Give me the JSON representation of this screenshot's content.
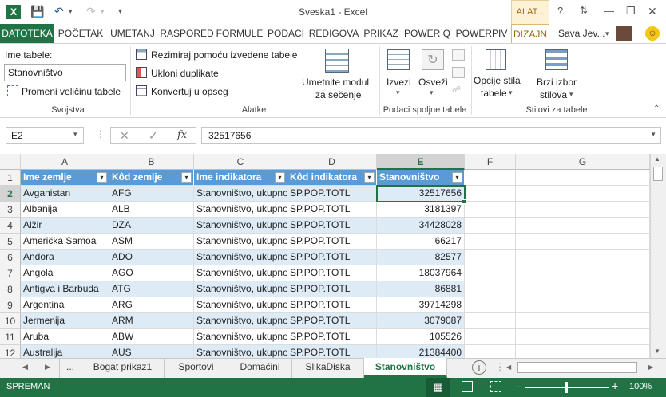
{
  "window": {
    "title": "Sveska1 - Excel",
    "contextual_tab_group": "ALAT...",
    "user_name": "Sava Jev..."
  },
  "ribbon_tabs": [
    "DATOTEKA",
    "POČETAK",
    "UMETANJ",
    "RASPORED",
    "FORMULE",
    "PODACI",
    "REDIGOVA",
    "PRIKAZ",
    "POWER Q",
    "POWERPIV",
    "DIZAJN"
  ],
  "ribbon": {
    "svojstva": {
      "name_label": "Ime tabele:",
      "name_value": "Stanovništvo",
      "resize_label": "Promeni veličinu tabele",
      "group_label": "Svojstva"
    },
    "alatke": {
      "pivot_label": "Rezimiraj pomoću izvedene tabele",
      "dupes_label": "Ukloni duplikate",
      "convert_label": "Konvertuj u opseg",
      "slicer_label_1": "Umetnite modul",
      "slicer_label_2": "za sečenje",
      "group_label": "Alatke"
    },
    "spoljni": {
      "export_label": "Izvezi",
      "refresh_label": "Osveži",
      "group_label": "Podaci spoljne tabele"
    },
    "stilovi": {
      "options_label_1": "Opcije stila",
      "options_label_2": "tabele",
      "quick_label_1": "Brzi izbor",
      "quick_label_2": "stilova",
      "group_label": "Stilovi za tabele"
    }
  },
  "formula_bar": {
    "name_box": "E2",
    "formula": "32517656"
  },
  "columns": [
    "A",
    "B",
    "C",
    "D",
    "E",
    "F",
    "G"
  ],
  "table_headers": [
    "Ime zemlje",
    "Kôd zemlje",
    "Ime indikatora",
    "Kôd indikatora",
    "Stanovništvo"
  ],
  "rows": [
    {
      "n": "2",
      "a": "Avganistan",
      "b": "AFG",
      "c": "Stanovništvo, ukupno",
      "d": "SP.POP.TOTL",
      "e": "32517656"
    },
    {
      "n": "3",
      "a": "Albanija",
      "b": "ALB",
      "c": "Stanovništvo, ukupno",
      "d": "SP.POP.TOTL",
      "e": "3181397"
    },
    {
      "n": "4",
      "a": "Alžir",
      "b": "DZA",
      "c": "Stanovništvo, ukupno",
      "d": "SP.POP.TOTL",
      "e": "34428028"
    },
    {
      "n": "5",
      "a": "Američka Samoa",
      "b": "ASM",
      "c": "Stanovništvo, ukupno",
      "d": "SP.POP.TOTL",
      "e": "66217"
    },
    {
      "n": "6",
      "a": "Andora",
      "b": "ADO",
      "c": "Stanovništvo, ukupno",
      "d": "SP.POP.TOTL",
      "e": "82577"
    },
    {
      "n": "7",
      "a": "Angola",
      "b": "AGO",
      "c": "Stanovništvo, ukupno",
      "d": "SP.POP.TOTL",
      "e": "18037964"
    },
    {
      "n": "8",
      "a": "Antigva i Barbuda",
      "b": "ATG",
      "c": "Stanovništvo, ukupno",
      "d": "SP.POP.TOTL",
      "e": "86881"
    },
    {
      "n": "9",
      "a": "Argentina",
      "b": "ARG",
      "c": "Stanovništvo, ukupno",
      "d": "SP.POP.TOTL",
      "e": "39714298"
    },
    {
      "n": "10",
      "a": "Jermenija",
      "b": "ARM",
      "c": "Stanovništvo, ukupno",
      "d": "SP.POP.TOTL",
      "e": "3079087"
    },
    {
      "n": "11",
      "a": "Aruba",
      "b": "ABW",
      "c": "Stanovništvo, ukupno",
      "d": "SP.POP.TOTL",
      "e": "105526"
    },
    {
      "n": "12",
      "a": "Australija",
      "b": "AUS",
      "c": "Stanovništvo, ukupno",
      "d": "SP.POP.TOTL",
      "e": "21384400"
    }
  ],
  "sheet_tabs": [
    "...",
    "Bogat prikaz1",
    "Sportovi",
    "Domaćini",
    "SlikaDiska",
    "Stanovništvo"
  ],
  "status": {
    "mode": "SPREMAN",
    "zoom": "100%"
  },
  "colors": {
    "accent": "#217346",
    "table_header": "#5b9bd5",
    "band": "#ddebf7"
  }
}
